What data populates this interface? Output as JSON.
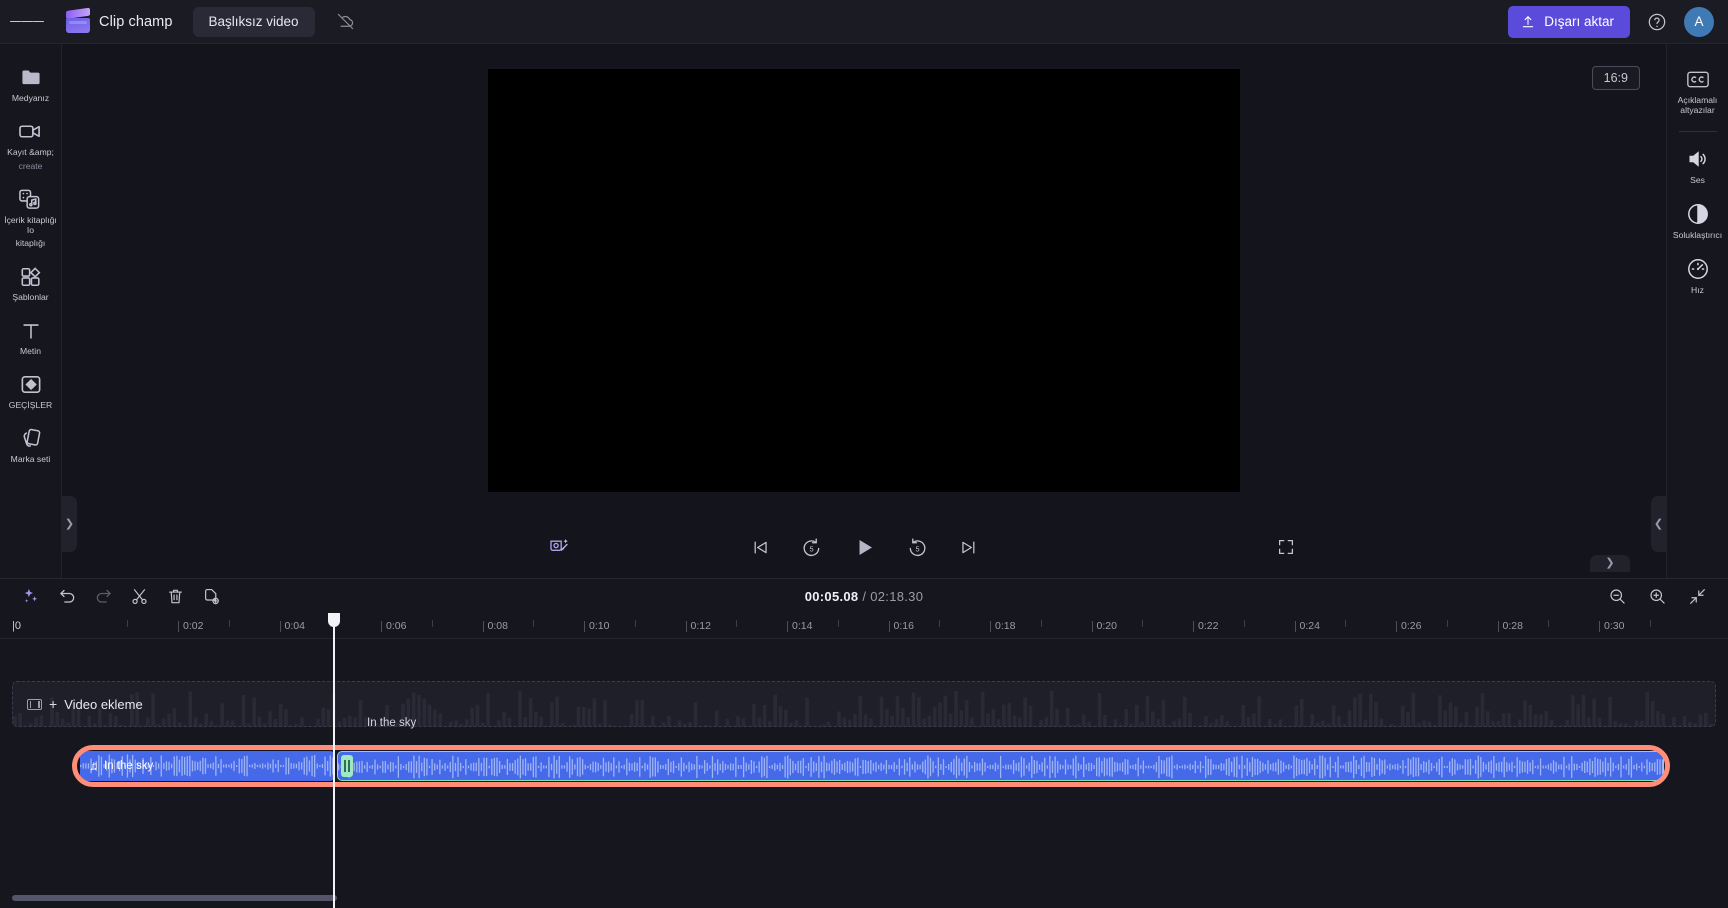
{
  "topbar": {
    "menu_icon": "hamburger-icon",
    "brand_name": "Clip champ",
    "project_title": "Başlıksız video",
    "cloud_off_icon": "cloud-off-icon",
    "export_label": "Dışarı aktar",
    "export_icon": "upload-icon",
    "help_icon": "help-circle-icon",
    "avatar_initial": "A",
    "accent_color": "#5b4bdb"
  },
  "left_rail": [
    {
      "label": "Medyanız",
      "icon": "folder-icon"
    },
    {
      "label": "Kayıt &amp;",
      "label2": "create",
      "icon": "video-camera-icon"
    },
    {
      "label": "İçerik kitaplığı Io",
      "label2": "kitaplığı",
      "icon": "content-library-icon"
    },
    {
      "label": "Şablonlar",
      "icon": "templates-icon"
    },
    {
      "label": "Metin",
      "icon": "text-icon"
    },
    {
      "label": "GEÇİŞLER",
      "icon": "transitions-icon"
    },
    {
      "label": "Marka seti",
      "icon": "brand-kit-icon"
    }
  ],
  "right_rail": [
    {
      "label": "Açıklamalı altyazılar",
      "icon": "closed-caption-icon"
    },
    {
      "label": "Ses",
      "icon": "speaker-icon"
    },
    {
      "label": "Soluklaştırıcı",
      "icon": "fade-icon"
    },
    {
      "label": "Hız",
      "icon": "speed-gauge-icon"
    }
  ],
  "preview": {
    "aspect_ratio": "16:9",
    "magic_icon": "magic-background-icon",
    "controls": [
      {
        "name": "skip-to-start",
        "icon": "skip-start-icon"
      },
      {
        "name": "rewind-5",
        "icon": "rewind-5-icon",
        "value": "5"
      },
      {
        "name": "play",
        "icon": "play-icon"
      },
      {
        "name": "forward-5",
        "icon": "forward-5-icon",
        "value": "5"
      },
      {
        "name": "skip-to-end",
        "icon": "skip-end-icon"
      }
    ],
    "fullscreen_icon": "fullscreen-icon"
  },
  "timeline": {
    "tools": [
      {
        "name": "ai-sparkle",
        "icon": "sparkle-icon",
        "enabled": true
      },
      {
        "name": "undo",
        "icon": "undo-arrow-icon",
        "enabled": true
      },
      {
        "name": "redo",
        "icon": "redo-arrow-icon",
        "enabled": false
      },
      {
        "name": "split",
        "icon": "scissors-icon",
        "enabled": true
      },
      {
        "name": "delete",
        "icon": "trash-icon",
        "enabled": true
      },
      {
        "name": "duplicate",
        "icon": "duplicate-icon",
        "enabled": true
      }
    ],
    "current_time": "00:05.08",
    "separator": "/",
    "total_time": "02:18.30",
    "zoom_out_icon": "zoom-out-icon",
    "zoom_in_icon": "zoom-in-icon",
    "fit_icon": "fit-to-screen-icon",
    "zero_label": "|0",
    "ruler_ticks": [
      "0:02",
      "0:04",
      "0:06",
      "0:08",
      "0:10",
      "0:12",
      "0:14",
      "0:16",
      "0:18",
      "0:20",
      "0:22",
      "0:24",
      "0:26",
      "0:28",
      "0:30"
    ],
    "video_track": {
      "add_label": "Video ekleme",
      "plus": "+",
      "film_icon": "film-strip-icon"
    },
    "ghost_clip_label": "In the sky",
    "audio_clip": {
      "title": "In the sky",
      "music_icon": "music-note-icon"
    },
    "selection_color": "#ff8d78",
    "clip_color": "#4569e8",
    "handle_color": "#9fe8c6"
  }
}
